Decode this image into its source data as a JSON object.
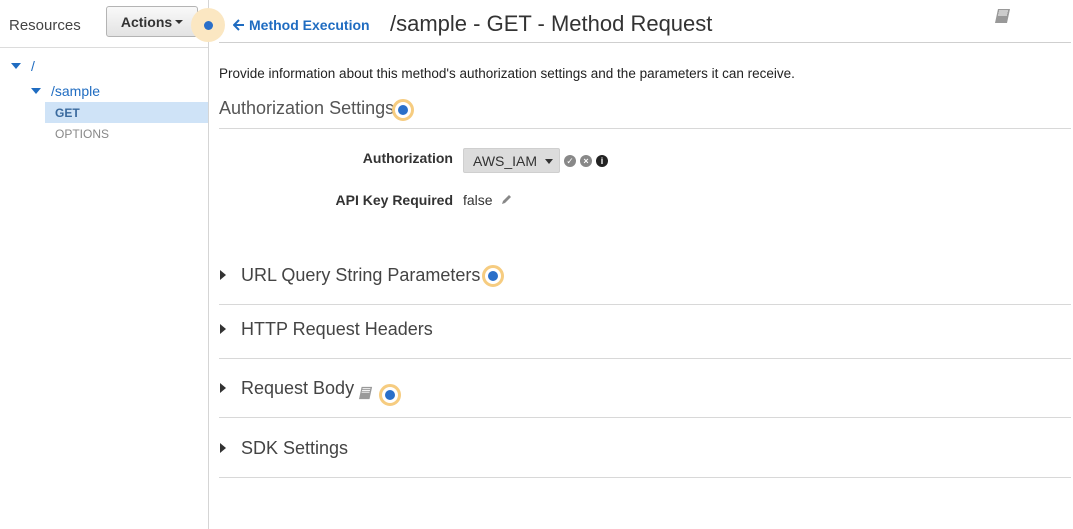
{
  "sidebar": {
    "resources_label": "Resources",
    "actions_label": "Actions",
    "tree": {
      "root": "/",
      "child": "/sample",
      "methods": [
        "GET",
        "OPTIONS"
      ]
    }
  },
  "header": {
    "back_link": "Method Execution",
    "title": "/sample - GET - Method Request"
  },
  "description": "Provide information about this method's authorization settings and the parameters it can receive.",
  "authorization": {
    "section_title": "Authorization Settings",
    "auth_label": "Authorization",
    "auth_value": "AWS_IAM",
    "api_key_label": "API Key Required",
    "api_key_value": "false"
  },
  "sections": [
    "URL Query String Parameters",
    "HTTP Request Headers",
    "Request Body",
    "SDK Settings"
  ],
  "icons": {
    "back": "arrow-left-icon",
    "docs": "book-icon",
    "confirm": "check-circle-icon",
    "cancel": "x-circle-icon",
    "info": "info-circle-icon",
    "edit": "pencil-icon"
  },
  "colors": {
    "link": "#1f6cc1",
    "selected_row": "#cfe3f7",
    "hotspot_ring": "#f6cc80",
    "hotspot_dot": "#2a6fc9"
  }
}
